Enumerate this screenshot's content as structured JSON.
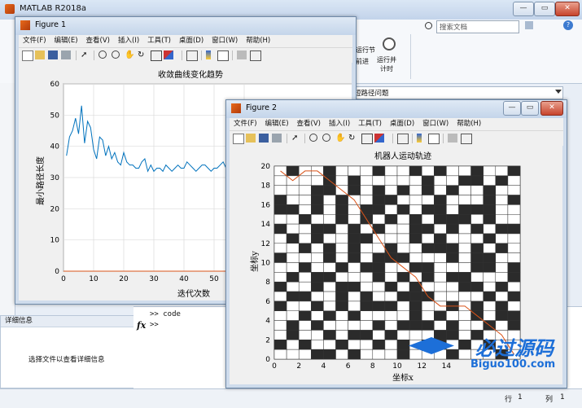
{
  "main": {
    "title": "MATLAB R2018a",
    "search_placeholder": "搜索文档",
    "ribbon_run_section": "运行节",
    "ribbon_advance": "前进",
    "ribbon_run_timer": "运行并\n计时",
    "path_text": "短路径问题",
    "details_title": "详细信息",
    "details_hint": "选择文件以查看详细信息",
    "cmd_prev": ">> code",
    "cmd_prompt": ">>",
    "fx": "fx",
    "status_row_label": "行",
    "status_row_value": "1",
    "status_col_label": "列",
    "status_col_value": "1"
  },
  "menus": [
    "文件(F)",
    "编辑(E)",
    "查看(V)",
    "插入(I)",
    "工具(T)",
    "桌面(D)",
    "窗口(W)",
    "帮助(H)"
  ],
  "figure1": {
    "title": "Figure 1",
    "chart_data": {
      "type": "line",
      "title": "收敛曲线变化趋势",
      "xlabel": "迭代次数",
      "ylabel": "最小路径长度",
      "xlim": [
        0,
        100
      ],
      "ylim": [
        0,
        60
      ],
      "xticks": [
        0,
        10,
        20,
        30,
        40,
        50,
        60
      ],
      "yticks": [
        0,
        10,
        20,
        30,
        40,
        50,
        60
      ],
      "grid": true,
      "series": [
        {
          "color": "#0072bd",
          "x": [
            1,
            2,
            3,
            4,
            5,
            6,
            7,
            8,
            9,
            10,
            11,
            12,
            13,
            14,
            15,
            16,
            17,
            18,
            19,
            20,
            21,
            22,
            23,
            24,
            25,
            26,
            27,
            28,
            29,
            30,
            31,
            32,
            33,
            34,
            35,
            36,
            37,
            38,
            39,
            40,
            41,
            42,
            43,
            44,
            45,
            46,
            47,
            48,
            49,
            50,
            51,
            52,
            53,
            54,
            55,
            56,
            57,
            58,
            59,
            60,
            61,
            62,
            63,
            64,
            65,
            66
          ],
          "y": [
            37,
            43,
            45,
            49,
            44,
            53,
            41,
            48,
            46,
            39,
            36,
            43,
            42,
            37,
            40,
            36,
            38,
            35,
            34,
            38,
            35,
            34,
            34,
            33,
            33,
            35,
            36,
            32,
            34,
            32,
            33,
            33,
            32,
            34,
            33,
            32,
            33,
            34,
            33,
            33,
            35,
            34,
            33,
            32,
            33,
            34,
            34,
            33,
            32,
            33,
            33,
            34,
            35,
            33,
            32,
            33,
            35,
            34,
            33,
            32,
            34,
            33,
            32,
            33,
            35,
            32
          ]
        },
        {
          "color": "#d95319",
          "x": [
            0,
            66
          ],
          "y": [
            0,
            0
          ]
        }
      ]
    }
  },
  "figure2": {
    "title": "Figure 2",
    "chart_data": {
      "type": "heatmap",
      "title": "机器人运动轨迹",
      "xlabel": "坐标x",
      "ylabel": "坐标y",
      "xlim": [
        0,
        20
      ],
      "ylim": [
        0,
        20
      ],
      "xticks": [
        0,
        2,
        4,
        6,
        8,
        10,
        12,
        14
      ],
      "yticks": [
        0,
        2,
        4,
        6,
        8,
        10,
        12,
        14,
        16,
        18,
        20
      ],
      "grid_rows_top_to_bottom": [
        "01001000100101001001",
        "00001010000010011010",
        "00011010101010100100",
        "10010100110001000101",
        "11010101101011011100",
        "00100101010101110100",
        "10011010100110101011",
        "01010011000101000100",
        "00101010010011101010",
        "10001010111000101100",
        "00100101100110001101",
        "01011000101010110001",
        "10010110010100011010",
        "01100101001110000101",
        "10010101110100101010",
        "00101010000101001011",
        "01010000101110100101",
        "01001011010001101000",
        "10100100101011010100",
        "00011010001000100010"
      ],
      "path": {
        "color": "#d95319",
        "x": [
          0.5,
          1.5,
          2.5,
          3.5,
          4.5,
          5.5,
          6.5,
          7.5,
          8.5,
          9.5,
          10.5,
          11.5,
          12.5,
          13.5,
          14.5,
          15.5,
          16.5,
          17.5,
          18.5,
          19.5
        ],
        "y": [
          19.5,
          18.5,
          19.5,
          19.5,
          18.5,
          17.5,
          16.5,
          14.5,
          12.5,
          10.5,
          9.5,
          8.5,
          6.5,
          5.5,
          5.5,
          5.5,
          4.5,
          3.5,
          2.5,
          0.5
        ]
      }
    }
  },
  "watermark": {
    "line1": "必过源码",
    "line2": "Biguo100.com"
  }
}
